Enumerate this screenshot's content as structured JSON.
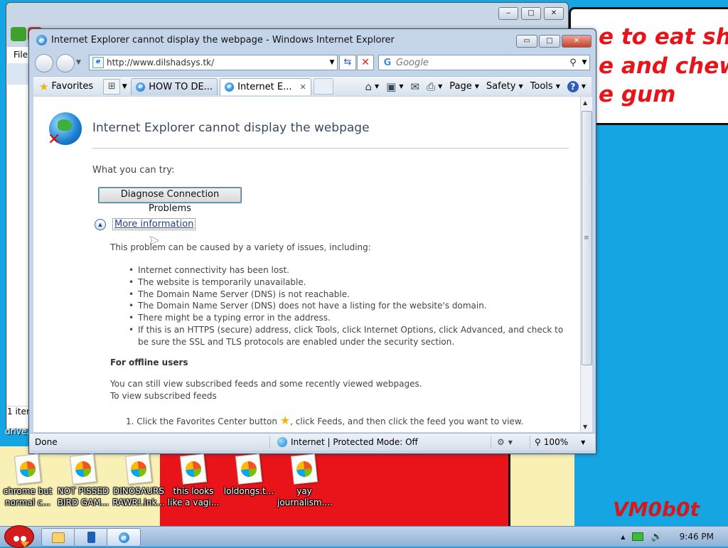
{
  "wallpaper": {
    "line1": "e to eat shit",
    "line2": "e and chew",
    "line3": "e gum",
    "signature": "VM0b0t"
  },
  "background_window": {
    "menu_file": "File",
    "status_items": "1 iter"
  },
  "desktop": {
    "drive_label": "drive.",
    "icons": [
      {
        "line1": "chrome but",
        "line2": "normal c..."
      },
      {
        "line1": "NOT PISSED",
        "line2": "BIRD GAM..."
      },
      {
        "line1": "DINOSAURS",
        "line2": "RAWR!.lnk..."
      },
      {
        "line1": "this looks",
        "line2": "like a vagi..."
      },
      {
        "line1": "loldongs.t...",
        "line2": ""
      },
      {
        "line1": "yay",
        "line2": "journalism...."
      }
    ]
  },
  "ie": {
    "title": "Internet Explorer cannot display the webpage - Windows Internet Explorer",
    "caption": {
      "minimize": "▭",
      "maximize": "□",
      "close": "✕"
    },
    "address": "http://www.dilshadsys.tk/",
    "search_placeholder": "Google",
    "favorites_label": "Favorites",
    "tabs": [
      {
        "label": "HOW TO DE..."
      },
      {
        "label": "Internet E...",
        "close": "✕"
      }
    ],
    "commands": {
      "page": "Page",
      "safety": "Safety",
      "tools": "Tools",
      "help": "?"
    },
    "page": {
      "heading": "Internet Explorer cannot display the webpage",
      "what_try": "What you can try:",
      "diagnose_button": "Diagnose Connection Problems",
      "more_info": "More information",
      "cause_intro": "This problem can be caused by a variety of issues, including:",
      "causes": [
        "Internet connectivity has been lost.",
        "The website is temporarily unavailable.",
        "The Domain Name Server (DNS) is not reachable.",
        "The Domain Name Server (DNS) does not have a listing for the website's domain.",
        "There might be a typing error in the address.",
        "If this is an HTTPS (secure) address, click Tools, click Internet Options, click Advanced, and check to be sure the SSL and TLS protocols are enabled under the security section."
      ],
      "offline_heading": "For offline users",
      "offline_text": "You can still view subscribed feeds and some recently viewed webpages.",
      "offline_sub": "To view subscribed feeds",
      "step1_prefix": "1.  Click the Favorites Center button",
      "step1_suffix": ", click Feeds, and then click the feed you want to view."
    },
    "status": {
      "done": "Done",
      "zone": "Internet | Protected Mode: Off",
      "zoom": "100%"
    }
  },
  "taskbar": {
    "clock": "9:46 PM"
  }
}
